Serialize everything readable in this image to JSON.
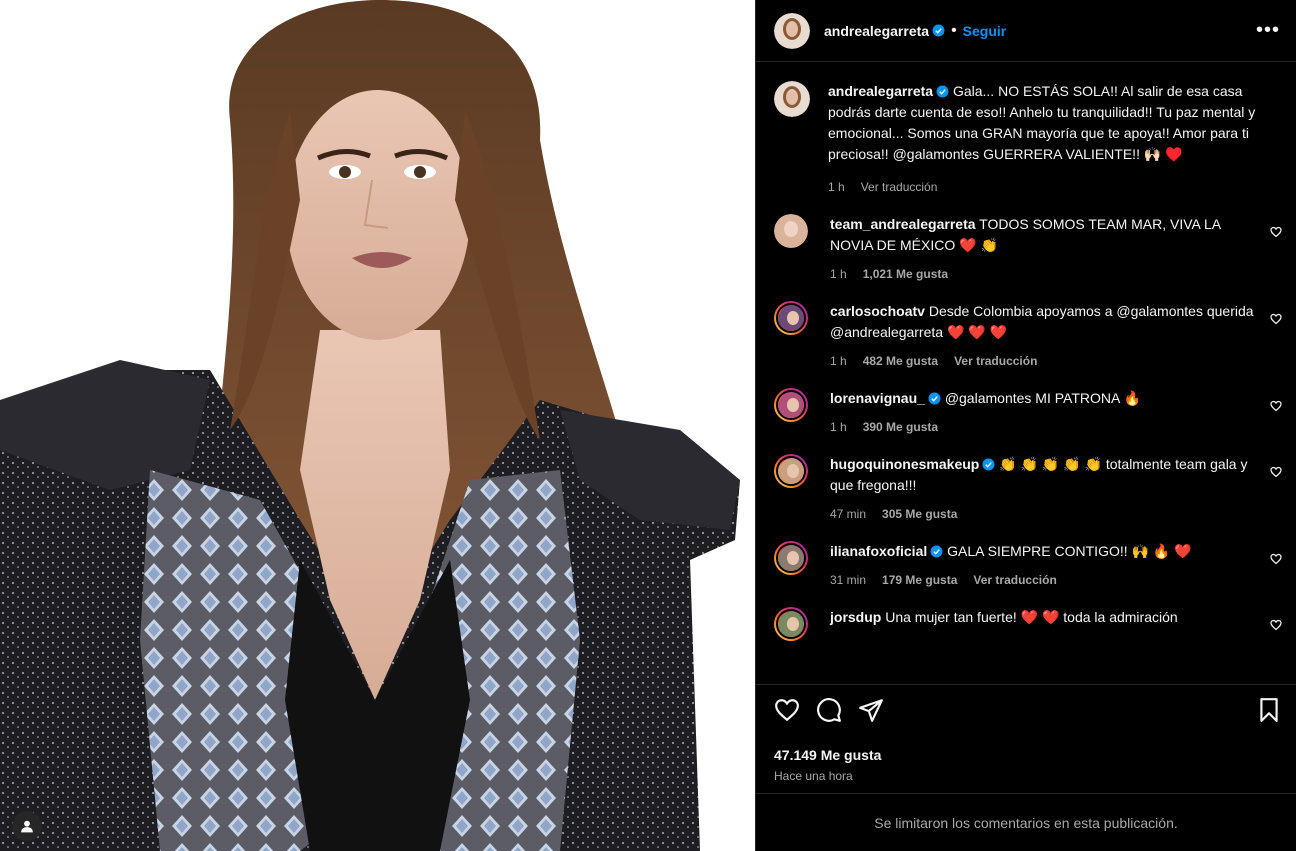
{
  "post": {
    "author": "andrealegarreta",
    "dot": "•",
    "follow_label": "Seguir",
    "more_label": "•••",
    "caption": {
      "user": "andrealegarreta",
      "text": "Gala... NO ESTÁS SOLA!! Al salir de esa casa podrás darte cuenta de eso!! Anhelo tu tranquilidad!! Tu paz mental y emocional... Somos una GRAN mayoría que te apoya!! Amor para ti preciosa!! @galamontes GUERRERA VALIENTE!! 🙌🏻 ♥️",
      "time": "1 h",
      "translate": "Ver traducción"
    },
    "likes": "47.149 Me gusta",
    "posted": "Hace una hora",
    "limited_notice": "Se limitaron los comentarios en esta publicación."
  },
  "comments": [
    {
      "user": "team_andrealegarreta",
      "verified": false,
      "text": "TODOS SOMOS TEAM MAR, VIVA LA NOVIA DE MÉXICO ❤️ 👏",
      "time": "1 h",
      "likes": "1,021 Me gusta",
      "translate": "",
      "avatar_color": "#d9b49a"
    },
    {
      "user": "carlosochoatv",
      "verified": false,
      "text": "Desde Colombia apoyamos a @galamontes querida @andrealegarreta ❤️ ❤️ ❤️",
      "time": "1 h",
      "likes": "482 Me gusta",
      "translate": "Ver traducción",
      "avatar_color": "#6b4a7a"
    },
    {
      "user": "lorenavignau_",
      "verified": true,
      "text": "@galamontes MI PATRONA 🔥",
      "time": "1 h",
      "likes": "390 Me gusta",
      "translate": "",
      "avatar_color": "#b0507a"
    },
    {
      "user": "hugoquinonesmakeup",
      "verified": true,
      "text": "👏 👏 👏 👏 👏 totalmente team gala y que fregona!!!",
      "time": "47 min",
      "likes": "305 Me gusta",
      "translate": "",
      "avatar_color": "#c8a080"
    },
    {
      "user": "ilianafoxoficial",
      "verified": true,
      "text": "GALA SIEMPRE CONTIGO!! 🙌 🔥 ❤️",
      "time": "31 min",
      "likes": "179 Me gusta",
      "translate": "Ver traducción",
      "avatar_color": "#8a7a70"
    },
    {
      "user": "jorsdup",
      "verified": false,
      "text": "Una mujer tan fuerte! ❤️ ❤️ toda la admiración",
      "time": "",
      "likes": "",
      "translate": "",
      "avatar_color": "#7a8a60"
    }
  ],
  "icons": {
    "like": "heart-icon",
    "comment": "comment-icon",
    "share": "share-icon",
    "save": "bookmark-icon",
    "tag": "user-tag-icon",
    "verified": "verified-badge-icon"
  },
  "colors": {
    "accent": "#0095f6",
    "background": "#000000",
    "secondary_text": "#a8a8a8"
  }
}
